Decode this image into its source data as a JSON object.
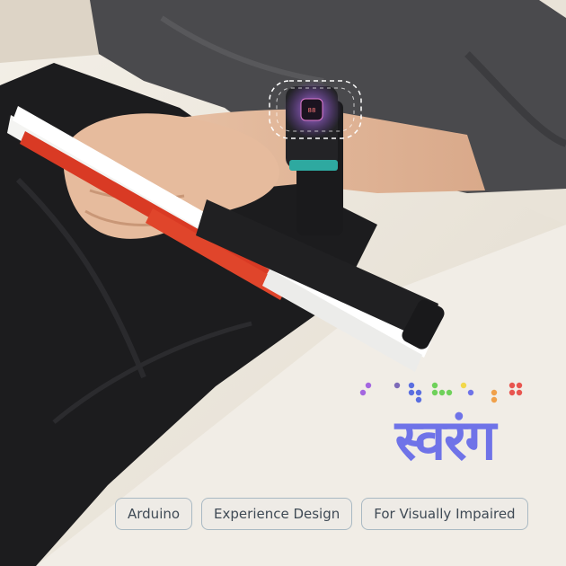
{
  "title": "स्वरंग",
  "tags": [
    "Arduino",
    "Experience Design",
    "For Visually Impaired"
  ],
  "colors": {
    "title": "#6f73e8",
    "tag_border": "#a9b9c3",
    "tag_text": "#3f4a55",
    "cane_red": "#d93a24",
    "braille_dots": [
      "#a466e0",
      "#6f73e8",
      "#7d6ab8",
      "#5a6ee0",
      "#6fd15a",
      "#f2d84a",
      "#f0a04a",
      "#e8554f"
    ]
  },
  "icons": [
    "braille-pattern",
    "cane",
    "wristband-device"
  ]
}
